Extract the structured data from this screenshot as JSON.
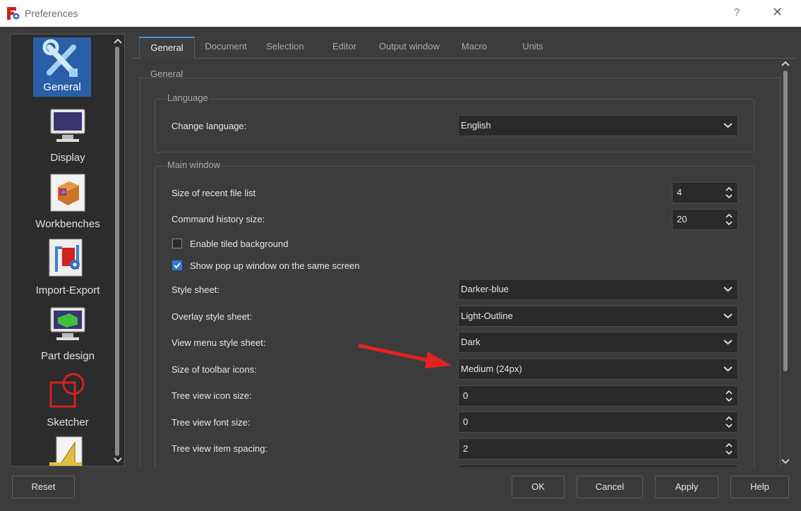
{
  "window": {
    "title": "Preferences",
    "help": "?",
    "close": "✕"
  },
  "sidebar": {
    "items": [
      {
        "label": "General",
        "icon": "tools-icon",
        "selected": true
      },
      {
        "label": "Display",
        "icon": "monitor-icon"
      },
      {
        "label": "Workbenches",
        "icon": "workbench-box-icon"
      },
      {
        "label": "Import-Export",
        "icon": "import-export-icon"
      },
      {
        "label": "Part design",
        "icon": "part-design-icon"
      },
      {
        "label": "Sketcher",
        "icon": "sketcher-icon"
      }
    ]
  },
  "tabs": [
    "General",
    "Document",
    "Selection",
    "Editor",
    "Output window",
    "Macro",
    "Units"
  ],
  "general": {
    "legend": "General",
    "language_group": {
      "legend": "Language",
      "change_language_label": "Change language:",
      "change_language_value": "English"
    },
    "main_window_group": {
      "legend": "Main window",
      "recent_files_label": "Size of recent file list",
      "recent_files_value": "4",
      "history_label": "Command history size:",
      "history_value": "20",
      "tiled_bg_label": "Enable tiled background",
      "tiled_bg_checked": false,
      "popup_label": "Show pop up window on the same screen",
      "popup_checked": true,
      "style_sheet_label": "Style sheet:",
      "style_sheet_value": "Darker-blue",
      "overlay_label": "Overlay style sheet:",
      "overlay_value": "Light-Outline",
      "view_menu_label": "View menu style sheet:",
      "view_menu_value": "Dark",
      "toolbar_icons_label": "Size of toolbar icons:",
      "toolbar_icons_value": "Medium (24px)",
      "tree_icon_label": "Tree view icon size:",
      "tree_icon_value": "0",
      "tree_font_label": "Tree view font size:",
      "tree_font_value": "0",
      "tree_spacing_label": "Tree view item spacing:",
      "tree_spacing_value": "2"
    }
  },
  "buttons": {
    "reset": "Reset",
    "ok": "OK",
    "cancel": "Cancel",
    "apply": "Apply",
    "help": "Help"
  },
  "colors": {
    "accent": "#2a5fa8",
    "arrow": "#e32222",
    "background": "#3c3c3c"
  }
}
